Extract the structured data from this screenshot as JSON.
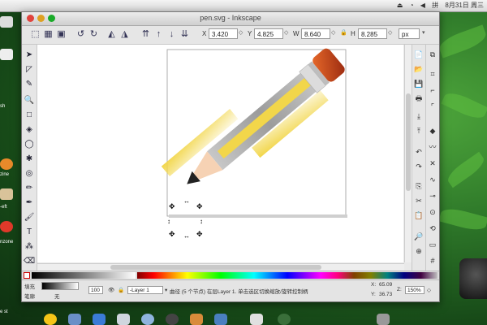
{
  "window": {
    "title": "pen.svg - Inkscape"
  },
  "menubar": {
    "right_text": "8月31日 周三",
    "input_icon": "拼"
  },
  "desktop": {
    "left_labels": [
      "sh",
      "zine",
      "-eft",
      "nzone",
      "e st"
    ]
  },
  "coords": {
    "x_label": "X",
    "x_value": "3.420",
    "y_label": "Y",
    "y_value": "4.825",
    "w_label": "W",
    "w_value": "8.640",
    "h_label": "H",
    "h_value": "8.285",
    "unit": "px"
  },
  "status": {
    "fill_label": "填充",
    "stroke_label": "笔廓",
    "stroke_value": "无",
    "opacity_value": "100",
    "layer_value": "-Layer 1",
    "message": "曲径 (5 个节点) 在层Layer 1. 单击选区切换缩放/旋转控制柄",
    "x_label": "X:",
    "x_value": "65.09",
    "y_label": "Y:",
    "y_value": "36.73",
    "zoom_label": "Z:",
    "zoom_value": "150%"
  },
  "colors": {
    "pencil_yellow": "#f2d64a",
    "eraser": "#c0451d",
    "ferrule": "#c8c8c8",
    "tip_wood": "#f6d2b4",
    "graphite": "#222222"
  }
}
